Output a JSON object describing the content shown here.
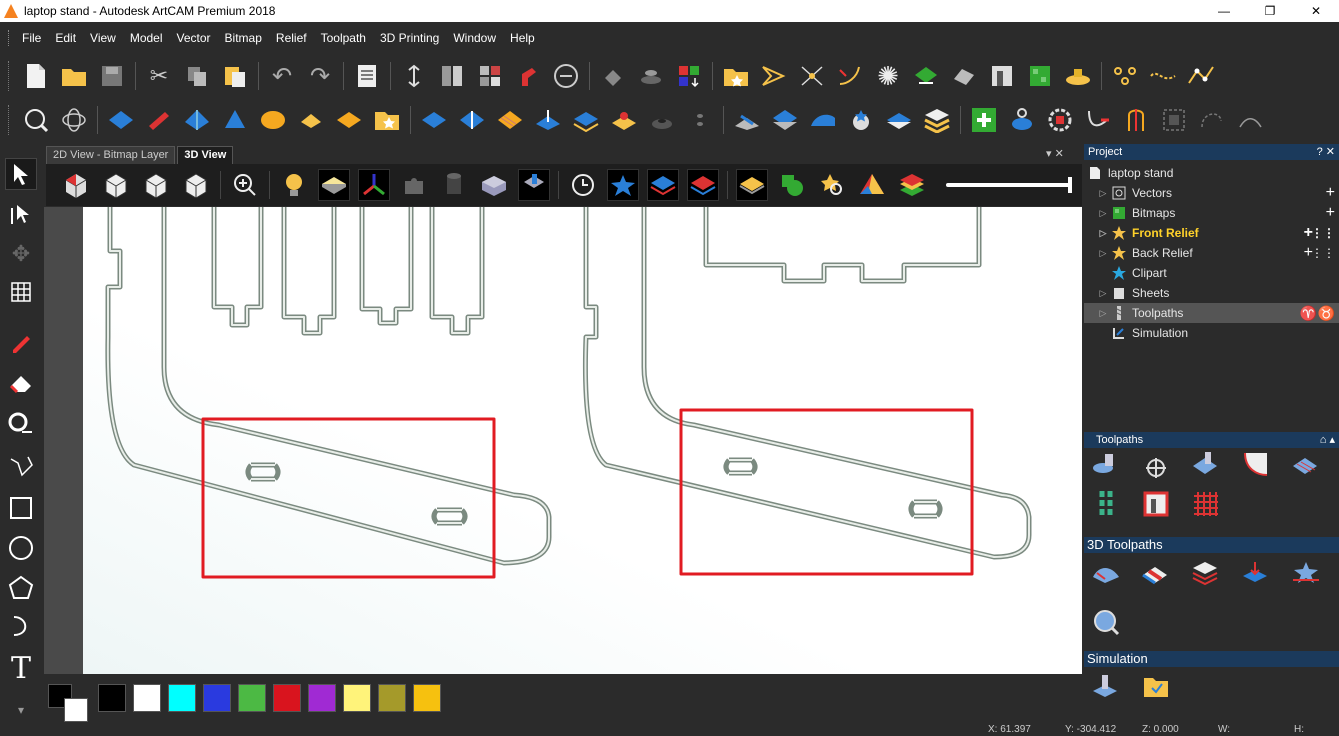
{
  "window": {
    "title": "laptop stand - Autodesk ArtCAM Premium 2018",
    "controls": [
      "—",
      "❐",
      "✕"
    ]
  },
  "menu": [
    "File",
    "Edit",
    "View",
    "Model",
    "Vector",
    "Bitmap",
    "Relief",
    "Toolpath",
    "3D Printing",
    "Window",
    "Help"
  ],
  "toolbar_row1_icons": [
    "new-file-icon",
    "open-folder-icon",
    "save-icon",
    "cut-icon",
    "copy-icon",
    "paste-icon",
    "undo-icon",
    "redo-icon",
    "notes-icon",
    "dimension-icon",
    "split-view-icon",
    "tile-view-icon",
    "magnet-icon",
    "measure-icon",
    "paint-bucket-icon",
    "layer-icon",
    "color-grid-icon",
    "favorites-folder-icon",
    "vector-trim-icon",
    "node-edit-icon",
    "curve-icon",
    "star-icon",
    "shape-icon",
    "bitmap-to-vector-icon",
    "frame-icon",
    "pattern-icon",
    "relief-icon",
    "node-group-icon",
    "node-chain-icon",
    "node-curve-icon"
  ],
  "toolbar_row2_icons": [
    "zoom-fit-icon",
    "orbit-icon",
    "relief-plane-icon",
    "extrude-icon",
    "spin-icon",
    "sweep-icon",
    "weave-icon",
    "sculpt-icon",
    "texture-icon",
    "clipart-star-icon",
    "relief-add-icon",
    "relief-merge-icon",
    "relief-stripe-icon",
    "relief-lift-icon",
    "relief-stack-icon",
    "relief-pin-icon",
    "relief-hole-icon",
    "relief-small-icon",
    "relief-slope-icon",
    "relief-smooth-icon",
    "relief-tilt-icon",
    "relief-disc-icon",
    "relief-diamond-icon",
    "relief-layers-icon",
    "add-green-icon",
    "bucket-icon",
    "gear-icon",
    "step-arrow-icon",
    "vise-icon",
    "dashed-box-icon",
    "curve-dash-icon",
    "arc-icon"
  ],
  "tabs": {
    "tab1": "2D View - Bitmap Layer",
    "tab2": "3D View",
    "controls": "▾ ✕"
  },
  "viewbar_icons": [
    "iso-view-icon",
    "top-view-icon",
    "front-view-icon",
    "side-view-icon",
    "zoom-in-icon",
    "light-icon",
    "plane-icon",
    "axes-icon",
    "puzzle-icon",
    "cylinder-icon",
    "block-icon",
    "tool-icon",
    "history-icon",
    "star-blue-icon",
    "layers-blue-icon",
    "layers-red-icon",
    "diamond-yellow-icon",
    "circle-green-icon",
    "search-star-icon",
    "pyramid-icon",
    "stack-color-icon"
  ],
  "left_tools": [
    "select-arrow-icon",
    "node-select-icon",
    "transform-icon",
    "mesh-icon",
    "pencil-icon",
    "eraser-icon",
    "measure-tool-icon",
    "polyline-icon",
    "rectangle-icon",
    "circle-icon",
    "polygon-icon",
    "arc-icon",
    "text-icon"
  ],
  "palette": {
    "primary": "#000000",
    "secondary": "#ffffff",
    "colors": [
      "#000000",
      "#ffffff",
      "#00ffff",
      "#2a3adf",
      "#4cb944",
      "#d9141e",
      "#a02ad3",
      "#fff37a",
      "#a59a2a",
      "#f6c10f"
    ]
  },
  "status": {
    "x": "X: 61.397",
    "y": "Y: -304.412",
    "z": "Z: 0.000",
    "w": "W:",
    "h": "H:"
  },
  "project": {
    "header": "Project",
    "header_controls": "? ✕",
    "root": "laptop stand",
    "items": [
      {
        "label": "Vectors",
        "icon": "vectors-icon"
      },
      {
        "label": "Bitmaps",
        "icon": "bitmaps-icon"
      },
      {
        "label": "Front Relief",
        "icon": "star-relief-icon"
      },
      {
        "label": "Back Relief",
        "icon": "star-relief-icon"
      },
      {
        "label": "Clipart",
        "icon": "clipart-star-icon"
      },
      {
        "label": "Sheets",
        "icon": "sheets-icon"
      },
      {
        "label": "Toolpaths",
        "icon": "toolpaths-icon"
      },
      {
        "label": "Simulation",
        "icon": "simulation-icon"
      }
    ]
  },
  "toolpaths_panel": {
    "header": "Toolpaths",
    "sections": {
      "toolpaths_icons": [
        "drill-icon",
        "cross-drill-icon",
        "profile-icon",
        "bevel-icon",
        "area-clear-icon",
        "spiral-icon",
        "panel-icon",
        "grid-icon"
      ],
      "toolpaths_3d": "3D Toolpaths",
      "toolpaths_3d_icons": [
        "machine-relief-icon",
        "z-level-icon",
        "stack-icon",
        "roughing-icon",
        "star-toolpath-icon",
        "inspect-icon"
      ],
      "simulation": "Simulation",
      "simulation_icons": [
        "sim-block-icon",
        "sim-folder-icon"
      ]
    }
  },
  "colors": {
    "accent": "#1b3a5c",
    "highlight": "#ffd22a",
    "annotation_red": "#e11b22"
  }
}
